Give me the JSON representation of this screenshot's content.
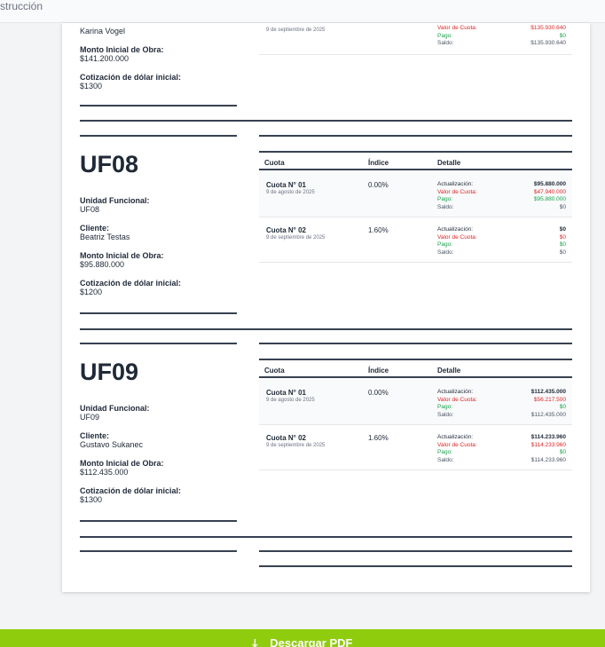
{
  "topbar": {
    "text": "strucción"
  },
  "partial": {
    "client": "Karina Vogel",
    "monto_label": "Monto Inicial de Obra:",
    "monto": "$141.200.000",
    "cot_label": "Cotización de dólar inicial:",
    "cot": "$1300",
    "row_date": "9 de septiembre de 2025",
    "detail": [
      {
        "label": "Valor de Cuota:",
        "value": "$135.930.640"
      },
      {
        "label": "Pago:",
        "value": "$0"
      },
      {
        "label": "Saldo:",
        "value": "$135.930.640"
      }
    ]
  },
  "units": [
    {
      "title": "UF08",
      "uf_label": "Unidad Funcional:",
      "uf": "UF08",
      "client_label": "Cliente:",
      "client": "Beatriz Testas",
      "monto_label": "Monto Inicial de Obra:",
      "monto": "$95.880.000",
      "cot_label": "Cotización de dólar inicial:",
      "cot": "$1200",
      "headers": {
        "cuota": "Cuota",
        "indice": "Índice",
        "detalle": "Detalle"
      },
      "rows": [
        {
          "cuota": "Cuota N° 01",
          "fecha": "9 de agosto de 2025",
          "indice": "0.00%",
          "act_label": "Actualización:",
          "act": "$95.880.000",
          "val_label": "Valor de Cuota:",
          "val": "$47.940.000",
          "pago_label": "Pago:",
          "pago": "$95.880.000",
          "saldo_label": "Saldo:",
          "saldo": "$0"
        },
        {
          "cuota": "Cuota N° 02",
          "fecha": "9 de septiembre de 2025",
          "indice": "1.60%",
          "act_label": "Actualización:",
          "act": "$0",
          "val_label": "Valor de Cuota:",
          "val": "$0",
          "pago_label": "Pago:",
          "pago": "$0",
          "saldo_label": "Saldo:",
          "saldo": "$0"
        }
      ]
    },
    {
      "title": "UF09",
      "uf_label": "Unidad Funcional:",
      "uf": "UF09",
      "client_label": "Cliente:",
      "client": "Gustavo Sukanec",
      "monto_label": "Monto Inicial de Obra:",
      "monto": "$112.435.000",
      "cot_label": "Cotización de dólar inicial:",
      "cot": "$1300",
      "headers": {
        "cuota": "Cuota",
        "indice": "Índice",
        "detalle": "Detalle"
      },
      "rows": [
        {
          "cuota": "Cuota N° 01",
          "fecha": "9 de agosto de 2025",
          "indice": "0.00%",
          "act_label": "Actualización:",
          "act": "$112.435.000",
          "val_label": "Valor de Cuota:",
          "val": "$56.217.500",
          "pago_label": "Pago:",
          "pago": "$0",
          "saldo_label": "Saldo:",
          "saldo": "$112.435.000"
        },
        {
          "cuota": "Cuota N° 02",
          "fecha": "9 de septiembre de 2025",
          "indice": "1.60%",
          "act_label": "Actualización:",
          "act": "$114.233.960",
          "val_label": "Valor de Cuota:",
          "val": "$114.233.960",
          "pago_label": "Pago:",
          "pago": "$0",
          "saldo_label": "Saldo:",
          "saldo": "$114.233.960"
        }
      ]
    }
  ],
  "download": {
    "label": "Descargar PDF",
    "icon": "download-icon"
  }
}
